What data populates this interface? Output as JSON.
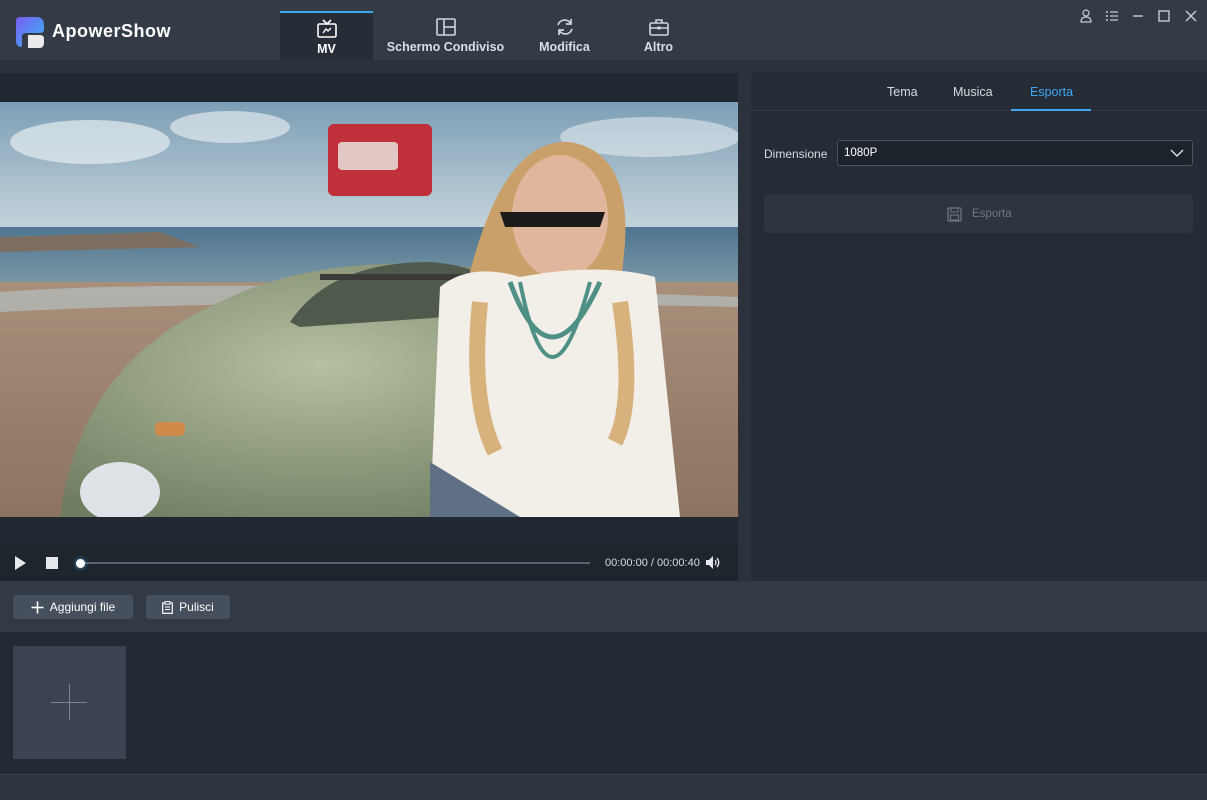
{
  "app": {
    "name": "ApowerShow"
  },
  "nav": {
    "tabs": [
      {
        "label": "MV",
        "icon": "tv-icon",
        "active": true
      },
      {
        "label": "Schermo Condiviso",
        "icon": "split-screen-icon",
        "active": false
      },
      {
        "label": "Modifica",
        "icon": "refresh-icon",
        "active": false
      },
      {
        "label": "Altro",
        "icon": "toolbox-icon",
        "active": false
      }
    ]
  },
  "window_controls": [
    "user-icon",
    "menu-icon",
    "minimize-icon",
    "maximize-icon",
    "close-icon"
  ],
  "player": {
    "current_time": "00:00:00",
    "separator": "/",
    "total_time": "00:00:40",
    "progress": 0
  },
  "right_panel": {
    "tabs": [
      {
        "label": "Tema",
        "active": false
      },
      {
        "label": "Musica",
        "active": false
      },
      {
        "label": "Esporta",
        "active": true
      }
    ],
    "dimension_label": "Dimensione",
    "dimension_value": "1080P",
    "export_label": "Esporta",
    "export_enabled": false
  },
  "toolbar": {
    "add_files_label": "Aggiungi file",
    "clear_label": "Pulisci"
  },
  "colors": {
    "accent": "#3ea6f2",
    "titlebar": "#333b46",
    "panel": "#252c35",
    "background": "#2b323c"
  }
}
